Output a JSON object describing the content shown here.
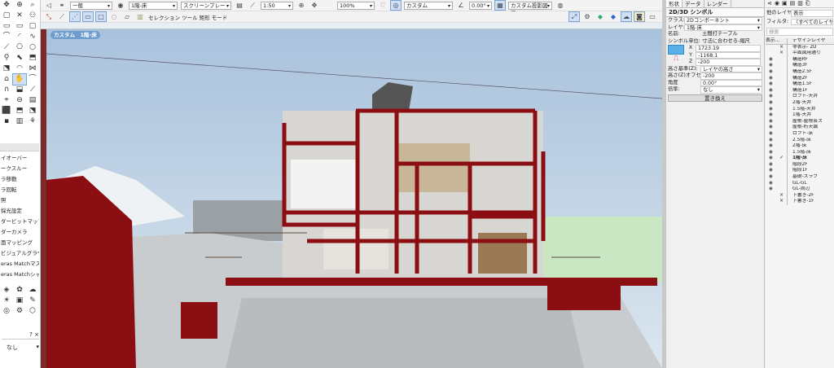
{
  "toolbar1": {
    "class_value": "一般",
    "layer_value": "1階-床",
    "plane_value": "スクリーンプレーン",
    "scale_value": "1:50",
    "zoom_value": "100%",
    "view_value": "カスタム",
    "angle_value": "0.00°",
    "projection_value": "カスタム投影図画"
  },
  "toolbar2": {
    "mode_label": "セレクション ツール 矩形 モード"
  },
  "viewport": {
    "view_tag": "カスタム　1階-床"
  },
  "palette": {
    "items": [
      "イオーバー",
      "ークスルー",
      "ラ移動",
      "ラ回転",
      "照",
      "採光設定",
      "ダービットマップ",
      "ダーカメラ",
      "面マッピング",
      "ビジュアルグラウンド",
      "eras Matchマスク",
      "eras Matchシャ..."
    ],
    "help_label": "?",
    "close_label": "×",
    "bottom_select": "なし"
  },
  "object_info": {
    "tabs": [
      "形状",
      "データ",
      "レンダー"
    ],
    "title": "2D/3D シンボル",
    "class_label": "クラス:",
    "class_value": "2Dコンポーネント",
    "layer_label": "レイヤ:",
    "layer_value": "1階-床",
    "name_label": "名前:",
    "name_value": "土間打テーブル",
    "unit_label": "シンボル単位:",
    "unit_value": "寸法に合わせる-縮尺",
    "x_label": "X",
    "x_value": "1723.19",
    "y_label": "Y",
    "y_value": "-1168.1",
    "z_label": "Z",
    "z_value": "-200",
    "height_ref_label": "高さ基準(Z):",
    "height_ref_value": "レイヤの高さ",
    "offset_label": "高さ(Z)オフセット:",
    "offset_value": "-200",
    "angle_label": "角度",
    "angle_value": "0.00°",
    "scale_label": "倍率:",
    "scale_value": "なし",
    "replace_button": "置き換え"
  },
  "layers": {
    "other_label": "他のレイヤを:",
    "other_value": "表示",
    "filter_label": "フィルタ:",
    "filter_value": "〈すべてのレイヤ〉",
    "search_placeholder": "検索",
    "col_visibility": "表示...",
    "col_name": "デザインレイヤ",
    "rows": [
      {
        "vis": "×",
        "name": "非表示- 2D"
      },
      {
        "vis": "×",
        "name": "平面図用通り"
      },
      {
        "vis": "eye",
        "name": "構造RF"
      },
      {
        "vis": "eye",
        "name": "構造3F"
      },
      {
        "vis": "eye",
        "name": "構造2.5F"
      },
      {
        "vis": "eye",
        "name": "構造2F"
      },
      {
        "vis": "eye",
        "name": "構造1.5F"
      },
      {
        "vis": "eye",
        "name": "構造1F"
      },
      {
        "vis": "eye",
        "name": "ロフト-天井"
      },
      {
        "vis": "eye",
        "name": "2階-天井"
      },
      {
        "vis": "eye",
        "name": "1.5階-天井"
      },
      {
        "vis": "eye",
        "name": "1階-天井"
      },
      {
        "vis": "eye",
        "name": "屋根-屋根長ス"
      },
      {
        "vis": "eye",
        "name": "屋根-桁天端"
      },
      {
        "vis": "eye",
        "name": "ロフト-床"
      },
      {
        "vis": "eye",
        "name": "2.5階-床"
      },
      {
        "vis": "eye",
        "name": "2階-床"
      },
      {
        "vis": "eye",
        "name": "1.5階-床"
      },
      {
        "vis": "eye",
        "name": "1階-床",
        "active": true
      },
      {
        "vis": "eye",
        "name": "階段2F"
      },
      {
        "vis": "eye",
        "name": "階段1F"
      },
      {
        "vis": "eye",
        "name": "基礎-スラブ"
      },
      {
        "vis": "eye",
        "name": "GL-GL"
      },
      {
        "vis": "eye",
        "name": "GL-周辺"
      },
      {
        "vis": "×",
        "name": "下書き-2F"
      },
      {
        "vis": "×",
        "name": "下書き-1F"
      }
    ]
  },
  "colors": {
    "section_red": "#8b0e12",
    "sky": "#b7cde2",
    "lawn": "#bfe0b6"
  }
}
